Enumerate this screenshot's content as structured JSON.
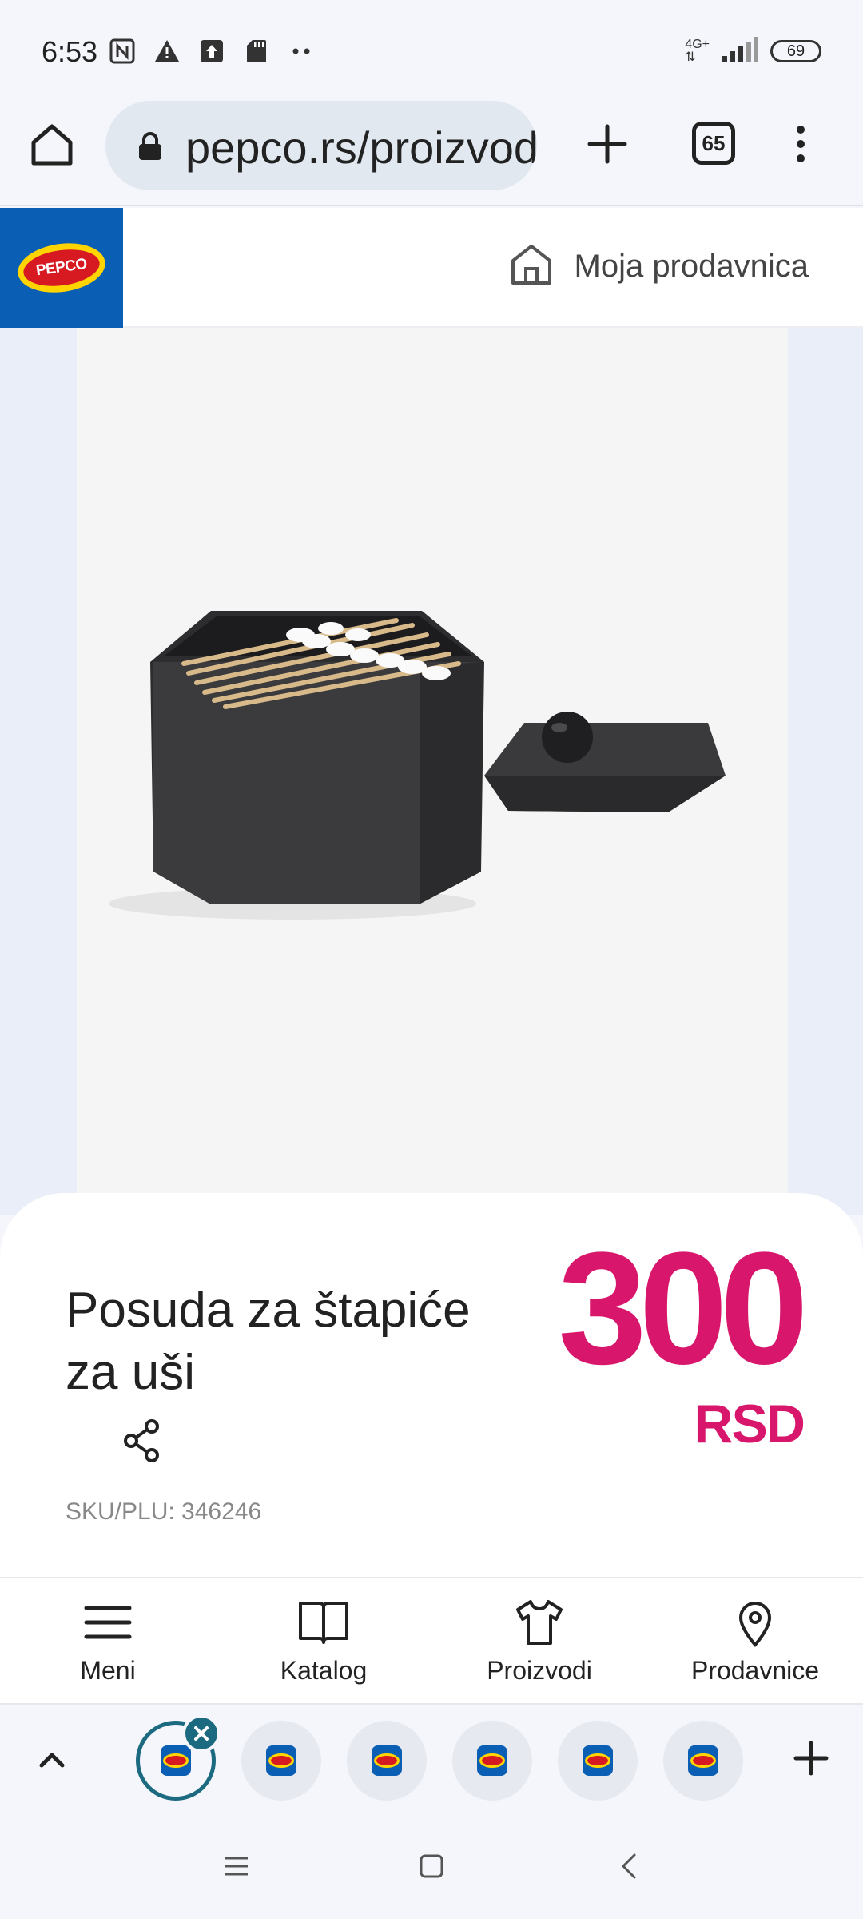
{
  "status_bar": {
    "time": "6:53",
    "network": "4G+",
    "battery": "69",
    "icons": [
      "nfc-icon",
      "warning-icon",
      "upload-icon",
      "sd-card-icon",
      "more-dots-icon",
      "signal-icon"
    ]
  },
  "browser": {
    "url": "pepco.rs/proizvodi",
    "tab_count": "65",
    "icons": [
      "home-icon",
      "lock-icon",
      "new-tab-plus-icon",
      "tab-switcher-icon",
      "more-vert-icon"
    ]
  },
  "site_header": {
    "logo_text": "PEPCO",
    "store_label": "Moja prodavnica",
    "brand_blue": "#0a5fb5"
  },
  "product": {
    "title": "Posuda za štapiće za uši",
    "price": "300",
    "currency": "RSD",
    "sku": "SKU/PLU: 346246",
    "price_color": "#d8166c"
  },
  "site_nav": {
    "items": [
      {
        "label": "Meni",
        "icon": "menu-icon"
      },
      {
        "label": "Katalog",
        "icon": "book-icon"
      },
      {
        "label": "Proizvodi",
        "icon": "tshirt-icon"
      },
      {
        "label": "Prodavnice",
        "icon": "location-pin-icon"
      }
    ]
  },
  "tab_strip": {
    "tabs": [
      "pepco",
      "pepco",
      "pepco",
      "pepco",
      "pepco",
      "pepco"
    ],
    "active_index": 0
  }
}
